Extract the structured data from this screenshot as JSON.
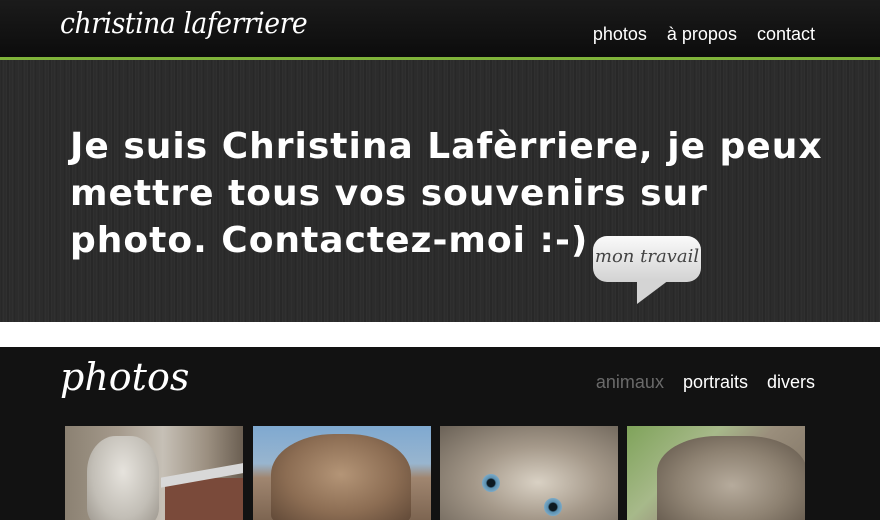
{
  "header": {
    "logo": "christina laferriere",
    "nav": [
      "photos",
      "à propos",
      "contact"
    ],
    "accent_color": "#7fb33a"
  },
  "hero": {
    "headline": "Je suis Christina Lafèrriere, je peux mettre tous vos souvenirs sur photo. Contactez-moi :-)",
    "cta_label": "mon travail"
  },
  "photos": {
    "title": "photos",
    "filters": [
      "animaux",
      "portraits",
      "divers"
    ],
    "active_filter": "animaux",
    "thumbnails": [
      {
        "subject": "horse"
      },
      {
        "subject": "elephant"
      },
      {
        "subject": "cat"
      },
      {
        "subject": "cat"
      }
    ]
  }
}
